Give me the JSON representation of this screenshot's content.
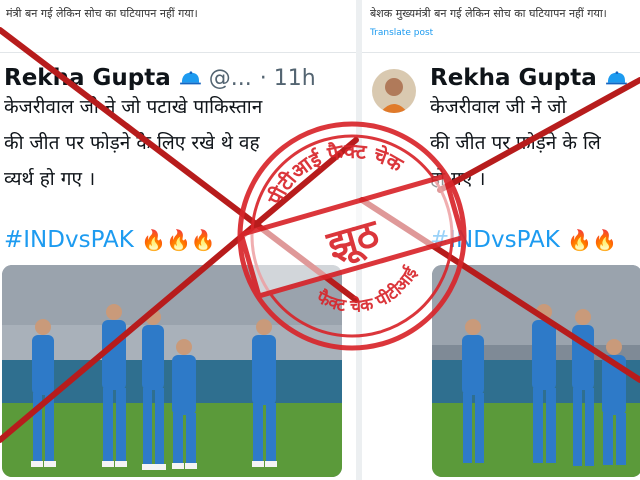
{
  "left_card": {
    "context_line": "मंत्री बन गई लेकिन सोच का घटियापन नहीं गया।",
    "author": "Rekha Gupta",
    "handle": "@...",
    "time": "· 11h",
    "lines": [
      "केजरीवाल जी ने जो पटाखे पाकिस्तान",
      "की जीत पर फोड़ने के लिए रखे थे वह",
      "व्यर्थ हो गए ।"
    ],
    "hashtag": "#INDvsPAK",
    "emoji": "🔥🔥🔥"
  },
  "right_card": {
    "context_line": "बेशक मुख्यमंत्री बन गई लेकिन सोच का घटियापन नहीं गया।",
    "translate_label": "Translate post",
    "author": "Rekha Gupta",
    "lines": [
      "केजरीवाल जी ने जो",
      "की जीत पर फोड़ने के लि",
      "हो गए ।"
    ],
    "hashtag": "#INDvsPAK",
    "emoji": "🔥🔥"
  },
  "stamp": {
    "top_arc": "पीटीआई फैक्ट चेक",
    "center_word": "झूठ",
    "bottom_arc": "फैक्ट चेक पीटीआई",
    "color": "#d8262b"
  },
  "colors": {
    "accent_blue": "#1d9bf0",
    "jersey_blue": "#2e7ac8",
    "cross_red": "#b71c1c"
  },
  "icons": {
    "verified": "blue-cap-icon"
  }
}
